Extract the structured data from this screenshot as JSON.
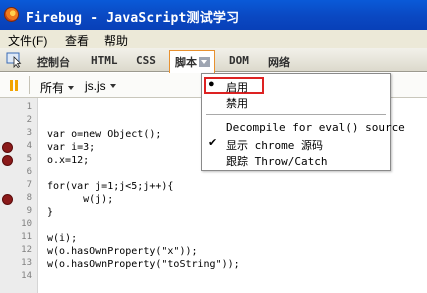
{
  "window": {
    "title": "Firebug - JavaScript测试学习",
    "app_icon": "firebug-app-icon"
  },
  "menubar": {
    "file": "文件(F)",
    "view": "查看",
    "help": "帮助"
  },
  "toolbar": {
    "inspect_icon": "inspect-pointer-icon",
    "tabs": [
      "控制台",
      "HTML",
      "CSS",
      "脚本",
      "DOM",
      "网络"
    ],
    "active_tab_index": 3
  },
  "subbar": {
    "pause_icon": "pause-icon",
    "filter_label": "所有",
    "file_label": "js.js"
  },
  "code": {
    "line_numbers": [
      "1",
      "2",
      "3",
      "4",
      "5",
      "6",
      "7",
      "8",
      "9",
      "10",
      "11",
      "12",
      "13",
      "14"
    ],
    "lines": [
      "",
      "",
      "var o=new Object();",
      "var i=3;",
      "o.x=12;",
      "",
      "for(var j=1;j<5;j++){",
      "      w(j);",
      "}",
      "",
      "w(i);",
      "w(o.hasOwnProperty(\"x\"));",
      "w(o.hasOwnProperty(\"toString\"));",
      ""
    ],
    "breakpoints": [
      "4",
      "5",
      "8"
    ],
    "breakpoint_color": "#8b1a1a"
  },
  "popup": {
    "items": [
      {
        "label": "启用",
        "mark": "●"
      },
      {
        "label": "禁用",
        "mark": ""
      },
      {
        "label": "Decompile for eval() source",
        "mark": ""
      },
      {
        "label": "显示 chrome 源码",
        "mark": "✔"
      },
      {
        "label": "跟踪 Throw/Catch",
        "mark": ""
      }
    ],
    "highlight_color": "#dd2222"
  },
  "colors": {
    "titlebar": "#0a4fc8",
    "active_tab_border": "#e8912f",
    "pause": "#f2a400"
  }
}
